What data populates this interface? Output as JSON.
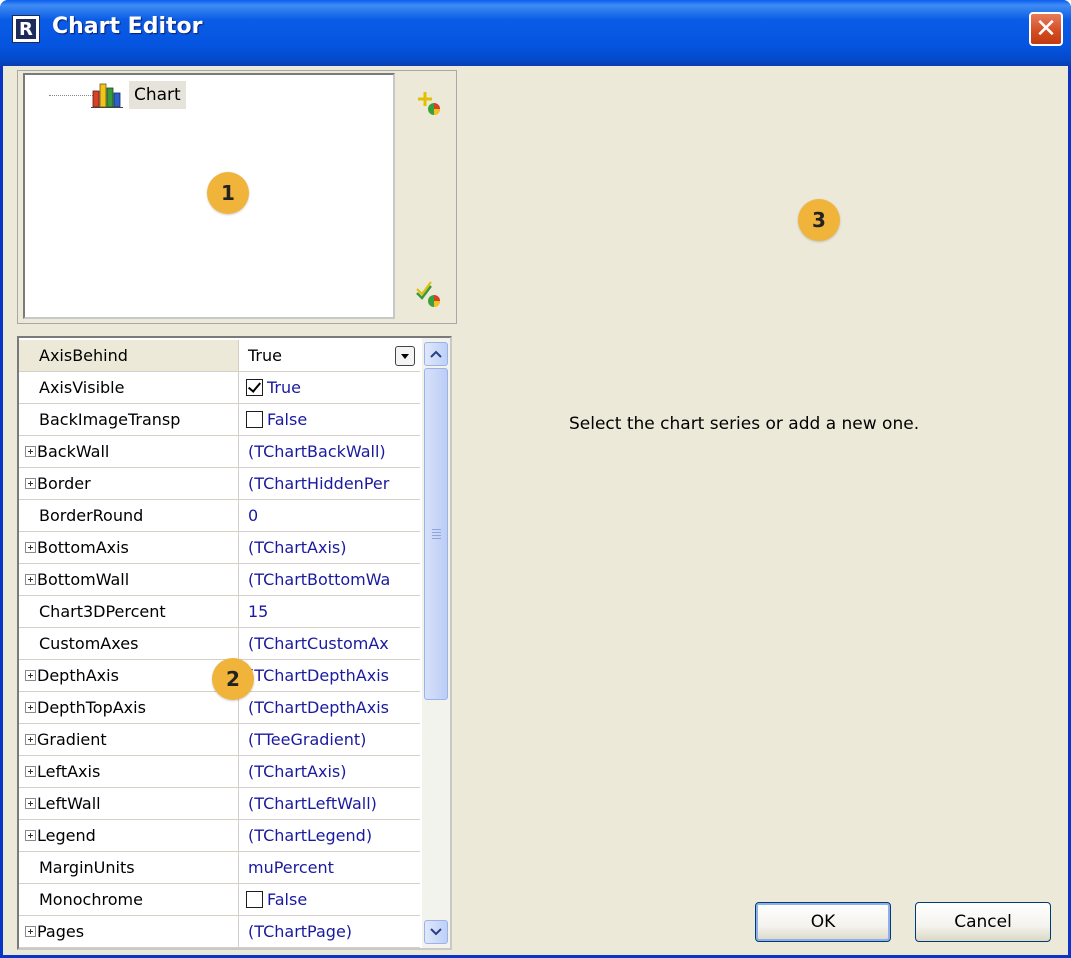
{
  "window": {
    "title": "Chart Editor",
    "icon": "fastreport-icon",
    "close_glyph": "✕"
  },
  "tree": {
    "root_label": "Chart"
  },
  "side_buttons": {
    "add": "add-series-icon",
    "edit": "edit-series-icon"
  },
  "badges": {
    "tree": "1",
    "grid": "2",
    "editor": "3"
  },
  "properties": [
    {
      "name": "AxisBehind",
      "value": "True",
      "expandable": false,
      "selected": true,
      "kind": "dropdown"
    },
    {
      "name": "AxisVisible",
      "value": "True",
      "expandable": false,
      "kind": "checkbox",
      "checked": true
    },
    {
      "name": "BackImageTransp",
      "value": "False",
      "expandable": false,
      "kind": "checkbox",
      "checked": false
    },
    {
      "name": "BackWall",
      "value": "(TChartBackWall)",
      "expandable": true
    },
    {
      "name": "Border",
      "value": "(TChartHiddenPer",
      "expandable": true
    },
    {
      "name": "BorderRound",
      "value": "0",
      "expandable": false
    },
    {
      "name": "BottomAxis",
      "value": "(TChartAxis)",
      "expandable": true
    },
    {
      "name": "BottomWall",
      "value": "(TChartBottomWa",
      "expandable": true
    },
    {
      "name": "Chart3DPercent",
      "value": "15",
      "expandable": false
    },
    {
      "name": "CustomAxes",
      "value": "(TChartCustomAx",
      "expandable": false
    },
    {
      "name": "DepthAxis",
      "value": "(TChartDepthAxis",
      "expandable": true
    },
    {
      "name": "DepthTopAxis",
      "value": "(TChartDepthAxis",
      "expandable": true
    },
    {
      "name": "Gradient",
      "value": "(TTeeGradient)",
      "expandable": true
    },
    {
      "name": "LeftAxis",
      "value": "(TChartAxis)",
      "expandable": true
    },
    {
      "name": "LeftWall",
      "value": "(TChartLeftWall)",
      "expandable": true
    },
    {
      "name": "Legend",
      "value": "(TChartLegend)",
      "expandable": true
    },
    {
      "name": "MarginUnits",
      "value": "muPercent",
      "expandable": false
    },
    {
      "name": "Monochrome",
      "value": "False",
      "expandable": false,
      "kind": "checkbox",
      "checked": false
    },
    {
      "name": "Pages",
      "value": "(TChartPage)",
      "expandable": true
    }
  ],
  "editor": {
    "hint": "Select the chart series or add a new one."
  },
  "buttons": {
    "ok": "OK",
    "cancel": "Cancel"
  },
  "colors": {
    "titlebar": "#0554e0",
    "badge": "#f0b43a",
    "face": "#ece9d8",
    "value_text": "#1a1aa0"
  }
}
